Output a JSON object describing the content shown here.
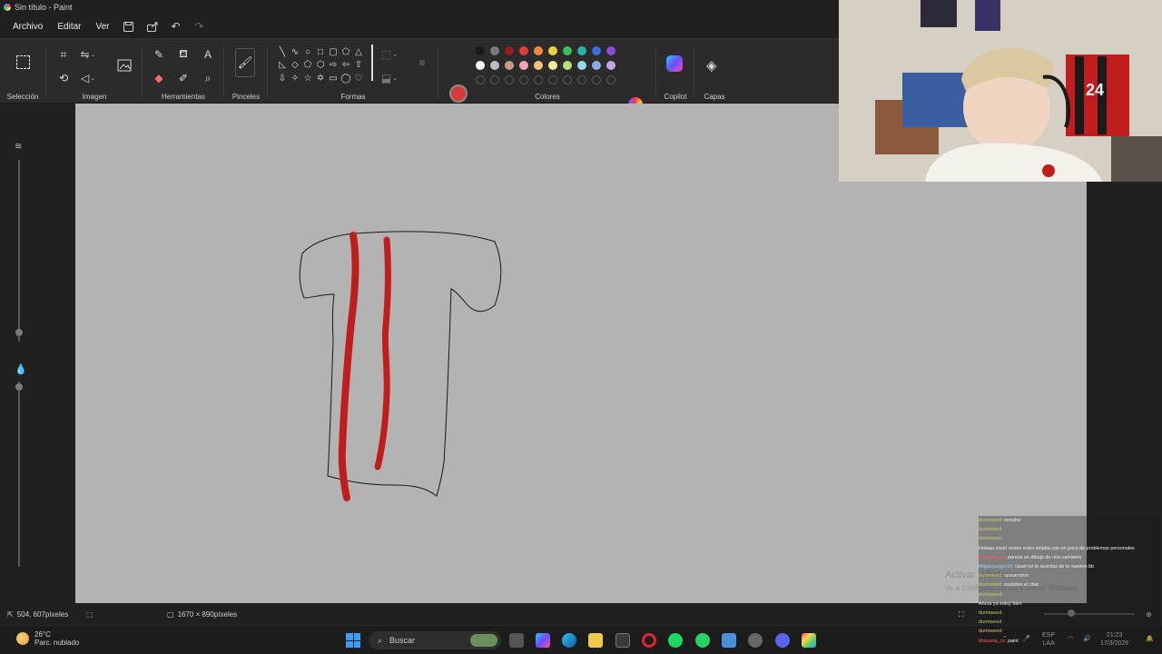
{
  "window": {
    "title": "Sin título - Paint"
  },
  "menu": {
    "items": [
      "Archivo",
      "Editar",
      "Ver"
    ]
  },
  "ribbon": {
    "groups": {
      "selection": "Selección",
      "image": "Imagen",
      "tools": "Herramientas",
      "brushes": "Pinceles",
      "shapes": "Formas",
      "colors": "Colores",
      "copilot": "Copilot",
      "layers": "Capas"
    },
    "colors": {
      "primary": "#d83a3a",
      "secondary": "#c8c8c8",
      "row1": [
        "#1a1a1a",
        "#7a7a7a",
        "#9b1c1c",
        "#e03b3b",
        "#f08a3a",
        "#f2d23a",
        "#3fbf5a",
        "#2fb0a8",
        "#3a6fd8",
        "#8a4ad8"
      ],
      "row2": [
        "#ffffff",
        "#bfbfbf",
        "#c89a8a",
        "#f4a5b5",
        "#f2c478",
        "#f4ec9a",
        "#b8e07a",
        "#9ad8e8",
        "#8aaee0",
        "#c0a8e0"
      ]
    }
  },
  "status": {
    "cursor_position": "504, 607píxeles",
    "canvas_size": "1670 × 890píxeles"
  },
  "taskbar": {
    "weather_temp": "26°C",
    "weather_desc": "Parc. nublado",
    "search_placeholder": "Buscar",
    "lang_1": "ESP",
    "lang_2": "LAA",
    "time": "21:23",
    "date": "17/3/2026"
  },
  "watermark": {
    "line1": "Activar Windows",
    "line2": "Ve a Configuración para activar Windows."
  },
  "chat": {
    "messages": [
      {
        "user": "durmweed",
        "user_color": "#c9c96a",
        "text": "xmejhw"
      },
      {
        "user": "durmweed",
        "user_color": "#c9c96a",
        "text": ""
      },
      {
        "user": "durmweed",
        "user_color": "#c9c96a",
        "text": ""
      },
      {
        "user": "",
        "user_color": "#6aa8ff",
        "text": "Holaaa cisarl recién entro estaba con un poco de problemas personales"
      },
      {
        "user": "Manuela_zz",
        "user_color": "#ff5a5a",
        "text": "parece un dibujo de una camiseta"
      },
      {
        "user": "Miguecanger19",
        "user_color": "#9ad8ff",
        "text": "cisarl no te acordas de lo nuestro bb"
      },
      {
        "user": "durmweed",
        "user_color": "#c9c96a",
        "text": "spmammm"
      },
      {
        "user": "durmweed",
        "user_color": "#c9c96a",
        "text": "exploten el chat"
      },
      {
        "user": "durmweed",
        "user_color": "#c9c96a",
        "text": ""
      },
      {
        "user": "",
        "user_color": "#6aa8ff",
        "text": "Ahora ya estoy bien"
      },
      {
        "user": "durmweed",
        "user_color": "#c9c96a",
        "text": ""
      },
      {
        "user": "durmweed",
        "user_color": "#c9c96a",
        "text": ""
      },
      {
        "user": "durmweed",
        "user_color": "#c9c96a",
        "text": ""
      },
      {
        "user": "Manuela_zz",
        "user_color": "#ff5a5a",
        "text": "paint"
      }
    ]
  }
}
